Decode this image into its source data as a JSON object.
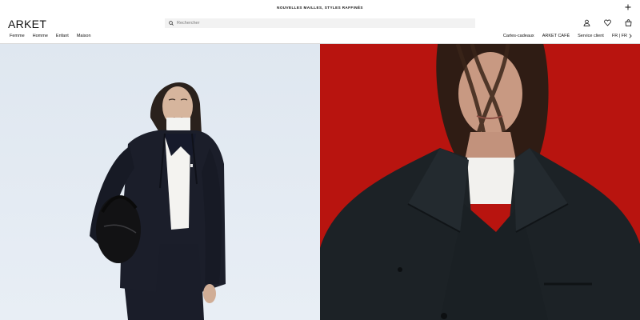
{
  "promo": {
    "text": "NOUVELLES MAILLES, STYLES RAFFINÉS"
  },
  "header": {
    "logo": "ARKET",
    "search_placeholder": "Rechercher",
    "icons": [
      "search-icon",
      "account-icon",
      "heart-icon",
      "bag-icon",
      "plus-icon",
      "chevron-right-icon"
    ]
  },
  "nav": {
    "left": [
      "Femme",
      "Homme",
      "Enfant",
      "Maison"
    ],
    "right": [
      "Cartes-cadeaux",
      "ARKET CAFÉ",
      "Service client"
    ],
    "locale": "FR | FR"
  },
  "colors": {
    "left_panel_bg": "#e1e9f2",
    "right_panel_bg": "#b8140f",
    "coat_dark": "#1b1e2a"
  }
}
